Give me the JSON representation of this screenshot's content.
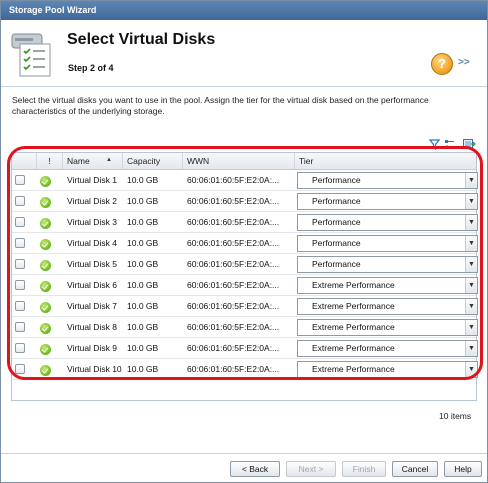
{
  "window": {
    "title": "Storage Pool Wizard"
  },
  "header": {
    "title": "Select Virtual Disks",
    "step": "Step 2 of 4",
    "help_symbol": "?",
    "forward_symbol": ">>"
  },
  "description": "Select the virtual disks you want to use in the pool. Assign the tier for the virtual disk based on the performance characteristics of the underlying storage.",
  "grid": {
    "tool_icons": [
      "filter-icon",
      "column-chooser-icon",
      "export-icon"
    ],
    "columns": {
      "status": "!",
      "name": "Name",
      "capacity": "Capacity",
      "wwn": "WWN",
      "tier": "Tier"
    },
    "sort": {
      "column": "Name",
      "direction": "ascending"
    },
    "rows": [
      {
        "name": "Virtual Disk 1",
        "capacity": "10.0 GB",
        "wwn": "60:06:01:60:5F:E2:0A:...",
        "tier": "Performance",
        "checked": false
      },
      {
        "name": "Virtual Disk 2",
        "capacity": "10.0 GB",
        "wwn": "60:06:01:60:5F:E2:0A:...",
        "tier": "Performance",
        "checked": false
      },
      {
        "name": "Virtual Disk 3",
        "capacity": "10.0 GB",
        "wwn": "60:06:01:60:5F:E2:0A:...",
        "tier": "Performance",
        "checked": false
      },
      {
        "name": "Virtual Disk 4",
        "capacity": "10.0 GB",
        "wwn": "60:06:01:60:5F:E2:0A:...",
        "tier": "Performance",
        "checked": false
      },
      {
        "name": "Virtual Disk 5",
        "capacity": "10.0 GB",
        "wwn": "60:06:01:60:5F:E2:0A:...",
        "tier": "Performance",
        "checked": false
      },
      {
        "name": "Virtual Disk 6",
        "capacity": "10.0 GB",
        "wwn": "60:06:01:60:5F:E2:0A:...",
        "tier": "Extreme Performance",
        "checked": false
      },
      {
        "name": "Virtual Disk 7",
        "capacity": "10.0 GB",
        "wwn": "60:06:01:60:5F:E2:0A:...",
        "tier": "Extreme Performance",
        "checked": false
      },
      {
        "name": "Virtual Disk 8",
        "capacity": "10.0 GB",
        "wwn": "60:06:01:60:5F:E2:0A:...",
        "tier": "Extreme Performance",
        "checked": false
      },
      {
        "name": "Virtual Disk 9",
        "capacity": "10.0 GB",
        "wwn": "60:06:01:60:5F:E2:0A:...",
        "tier": "Extreme Performance",
        "checked": false
      },
      {
        "name": "Virtual Disk 10",
        "capacity": "10.0 GB",
        "wwn": "60:06:01:60:5F:E2:0A:...",
        "tier": "Extreme Performance",
        "checked": false
      }
    ],
    "item_count": "10 items"
  },
  "buttons": {
    "back": "< Back",
    "next": "Next >",
    "finish": "Finish",
    "cancel": "Cancel",
    "help": "Help"
  },
  "colors": {
    "titlebar": "#4a73a5",
    "highlight": "#e0121b",
    "status_ok": "#6bb51e"
  }
}
